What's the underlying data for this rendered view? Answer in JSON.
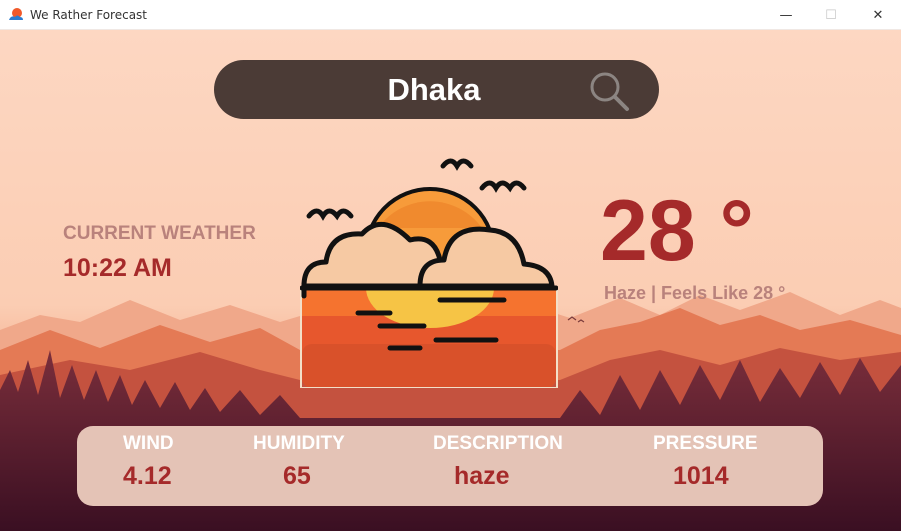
{
  "window": {
    "title": "We Rather Forecast",
    "controls": {
      "minimize": "—",
      "maximize": "☐",
      "close": "✕"
    }
  },
  "search": {
    "value": "Dhaka",
    "icon": "search-icon"
  },
  "current": {
    "label": "CURRENT WEATHER",
    "time": "10:22 AM"
  },
  "weather": {
    "temperature": "28 °",
    "condition_line": "Haze | Feels Like 28 °",
    "icon": "sunset-clouds-birds-icon"
  },
  "stats": [
    {
      "label": "WIND",
      "value": "4.12"
    },
    {
      "label": "HUMIDITY",
      "value": "65"
    },
    {
      "label": "DESCRIPTION",
      "value": "haze"
    },
    {
      "label": "PRESSURE",
      "value": "1014"
    }
  ],
  "colors": {
    "sky": "#fbd1b8",
    "accent": "#a52a2a",
    "muted": "#b9827c",
    "search_bg": "#4b3b36",
    "panel_bg": "#e4c3b6"
  }
}
